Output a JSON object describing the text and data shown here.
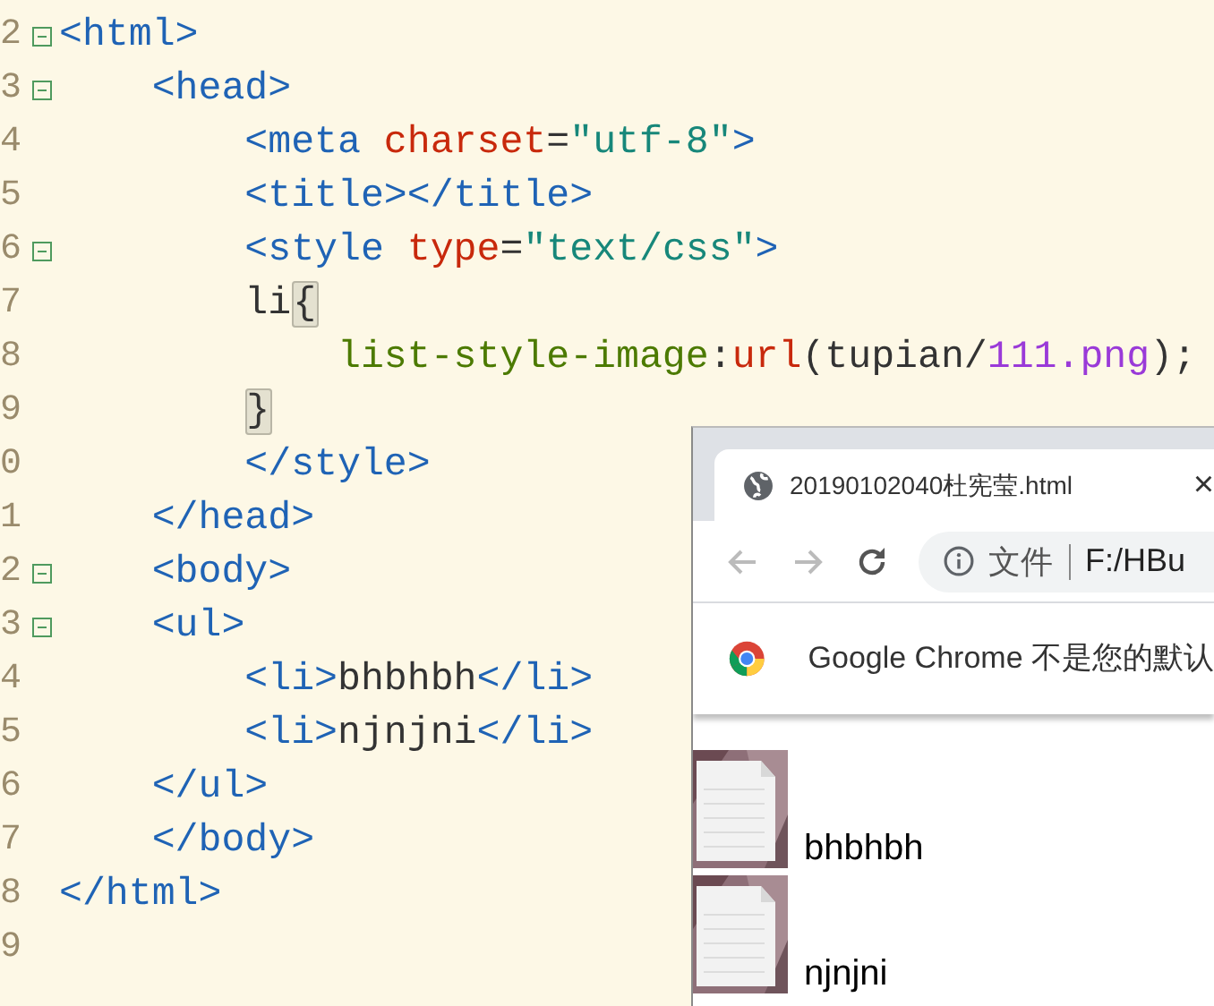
{
  "editor": {
    "lines": [
      {
        "number": "2",
        "fold": true,
        "tokens": [
          {
            "text": "<html>",
            "kind": "tag"
          }
        ]
      },
      {
        "number": "3",
        "fold": true,
        "tokens": [
          {
            "text": "    <head>",
            "kind": "tag"
          }
        ]
      },
      {
        "number": "4",
        "fold": false,
        "tokens": [
          {
            "text": "        <meta ",
            "kind": "tag"
          },
          {
            "text": "charset",
            "kind": "attr"
          },
          {
            "text": "=",
            "kind": "plain"
          },
          {
            "text": "\"utf-8\"",
            "kind": "string"
          },
          {
            "text": ">",
            "kind": "tag"
          }
        ]
      },
      {
        "number": "5",
        "fold": false,
        "tokens": [
          {
            "text": "        <title></title>",
            "kind": "tag"
          }
        ]
      },
      {
        "number": "6",
        "fold": true,
        "tokens": [
          {
            "text": "        <style ",
            "kind": "tag"
          },
          {
            "text": "type",
            "kind": "attr"
          },
          {
            "text": "=",
            "kind": "plain"
          },
          {
            "text": "\"text/css\"",
            "kind": "string"
          },
          {
            "text": ">",
            "kind": "tag"
          }
        ]
      },
      {
        "number": "7",
        "fold": false,
        "tokens": [
          {
            "text": "        li",
            "kind": "plain"
          },
          {
            "text": "{",
            "kind": "brace-match"
          }
        ]
      },
      {
        "number": "8",
        "fold": false,
        "tokens": [
          {
            "text": "            list-style-image",
            "kind": "prop"
          },
          {
            "text": ":",
            "kind": "plain"
          },
          {
            "text": "url",
            "kind": "func"
          },
          {
            "text": "(tupian/",
            "kind": "plain"
          },
          {
            "text": "111.png",
            "kind": "number"
          },
          {
            "text": ");",
            "kind": "plain"
          }
        ]
      },
      {
        "number": "9",
        "fold": false,
        "tokens": [
          {
            "text": "        }",
            "kind": "brace-match"
          }
        ]
      },
      {
        "number": "0",
        "fold": false,
        "tokens": [
          {
            "text": "        </style>",
            "kind": "tag"
          }
        ]
      },
      {
        "number": "1",
        "fold": false,
        "tokens": [
          {
            "text": "    </head>",
            "kind": "tag"
          }
        ]
      },
      {
        "number": "2",
        "fold": true,
        "tokens": [
          {
            "text": "    <body>",
            "kind": "tag"
          }
        ]
      },
      {
        "number": "3",
        "fold": true,
        "tokens": [
          {
            "text": "    <ul>",
            "kind": "tag"
          }
        ]
      },
      {
        "number": "4",
        "fold": false,
        "tokens": [
          {
            "text": "        <li>",
            "kind": "tag"
          },
          {
            "text": "bhbhbh",
            "kind": "plain"
          },
          {
            "text": "</li>",
            "kind": "tag"
          }
        ]
      },
      {
        "number": "5",
        "fold": false,
        "tokens": [
          {
            "text": "        <li>",
            "kind": "tag"
          },
          {
            "text": "njnjni",
            "kind": "plain"
          },
          {
            "text": "</li>",
            "kind": "tag"
          }
        ]
      },
      {
        "number": "6",
        "fold": false,
        "tokens": [
          {
            "text": "    </ul>",
            "kind": "tag"
          }
        ]
      },
      {
        "number": "7",
        "fold": false,
        "tokens": [
          {
            "text": "    </body>",
            "kind": "tag"
          }
        ]
      },
      {
        "number": "8",
        "fold": false,
        "tokens": [
          {
            "text": "</html>",
            "kind": "tag"
          }
        ]
      },
      {
        "number": "9",
        "fold": false
      }
    ]
  },
  "browser": {
    "tab": {
      "title": "20190102040杜宪莹.html",
      "close": "×"
    },
    "address": {
      "scheme": "文件",
      "url": "F:/HBu"
    },
    "infobar": {
      "message": "Google Chrome 不是您的默认"
    },
    "list": [
      {
        "text": "bhbhbh"
      },
      {
        "text": "njnjni"
      }
    ]
  }
}
